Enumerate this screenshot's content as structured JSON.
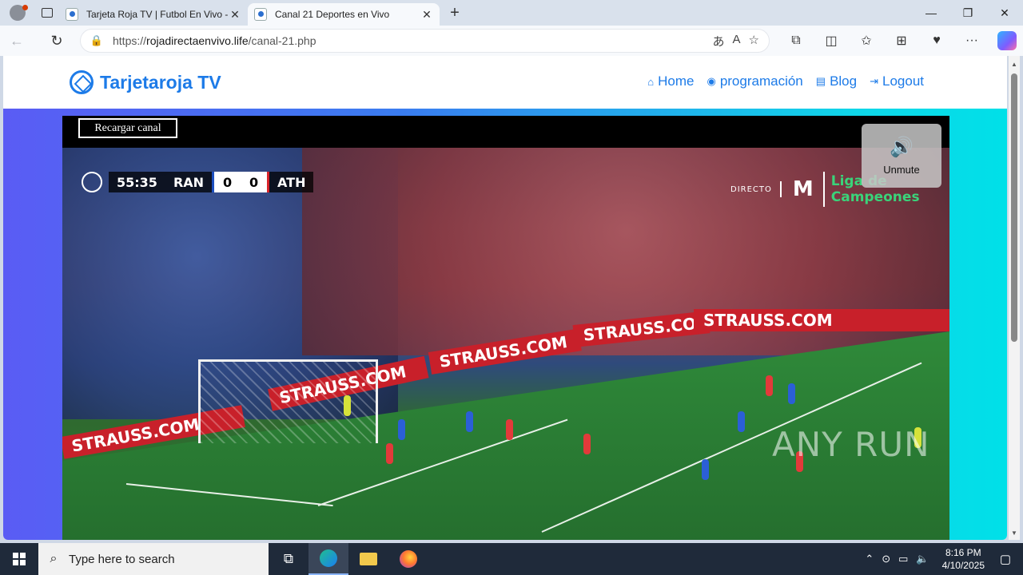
{
  "browser": {
    "tabs": [
      {
        "title": "Tarjeta Roja TV | Futbol En Vivo - G",
        "active": false
      },
      {
        "title": "Canal 21 Deportes en Vivo",
        "active": true
      }
    ],
    "url_prefix": "https://",
    "url_domain": "rojadirectaenvivo.life",
    "url_path": "/canal-21.php"
  },
  "site": {
    "logo_text": "Tarjetaroja TV",
    "nav": [
      {
        "label": "Home",
        "icon": "home-icon"
      },
      {
        "label": "programación",
        "icon": "gamepad-icon"
      },
      {
        "label": "Blog",
        "icon": "newspaper-icon"
      },
      {
        "label": "Logout",
        "icon": "sign-out-icon"
      }
    ]
  },
  "player": {
    "reload_label": "Recargar canal",
    "unmute_label": "Unmute",
    "scorebug": {
      "time": "55:35",
      "home": "RAN",
      "home_score": "0",
      "away_score": "0",
      "away": "ATH"
    },
    "broadcast": {
      "directo": "DIRECTO",
      "brand": "M",
      "liga_line1": "Liga de",
      "liga_line2": "Campeones"
    },
    "ad_text": "STRAUSS.COM"
  },
  "watermark": "ANY RUN",
  "taskbar": {
    "search_placeholder": "Type here to search",
    "time": "8:16 PM",
    "date": "4/10/2025"
  },
  "colors": {
    "accent": "#1d7be8",
    "taskbar": "#1f2a3a"
  }
}
